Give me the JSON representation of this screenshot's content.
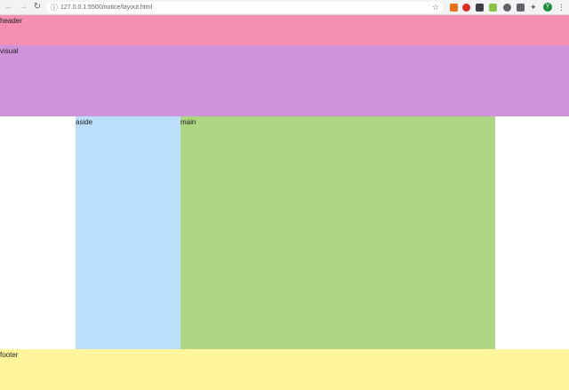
{
  "browser": {
    "back_icon": "arrow-left-icon",
    "forward_icon": "arrow-right-icon",
    "reload_icon": "reload-icon",
    "url": "127.0.0.1:5500/notice/layout.html",
    "avatar_initial": "Y"
  },
  "page": {
    "header_label": "header",
    "visual_label": "visual",
    "aside_label": "aside",
    "main_label": "main",
    "footer_label": "footer"
  },
  "colors": {
    "header": "#f48fb1",
    "visual": "#ce93d8",
    "aside": "#bbdefb",
    "main": "#aed581",
    "footer": "#fff59d"
  }
}
